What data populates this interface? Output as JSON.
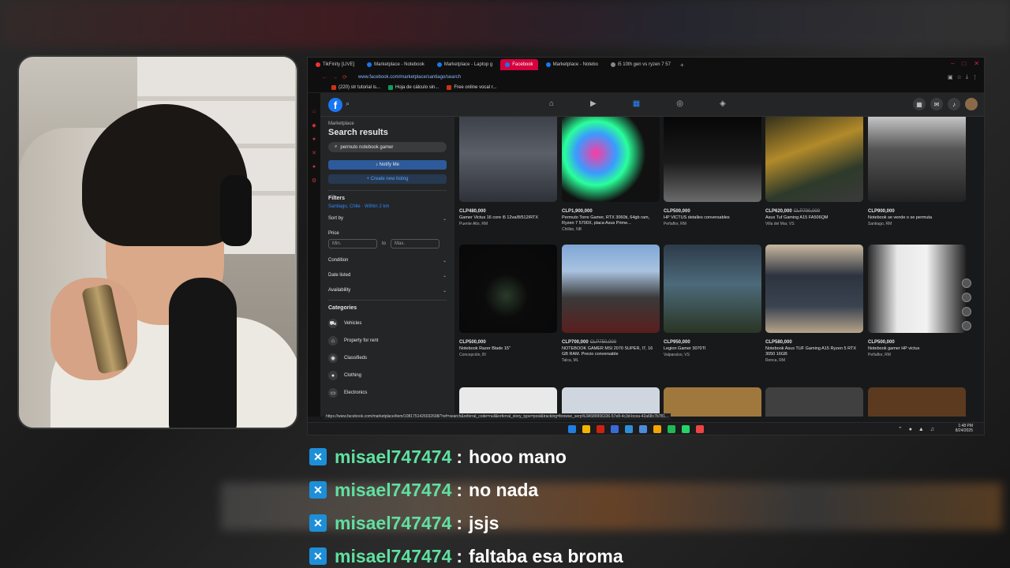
{
  "browser": {
    "tabs": [
      {
        "label": "TikFinity [LIVE]",
        "active": false
      },
      {
        "label": "Marketplace - Notebook",
        "active": false
      },
      {
        "label": "Marketplace - Laptop g",
        "active": false
      },
      {
        "label": "Facebook",
        "active": true
      },
      {
        "label": "Marketplace - Notebo",
        "active": false
      },
      {
        "label": "i5 10th gen vs ryzen 7 57",
        "active": false
      }
    ],
    "url": "www.facebook.com/marketplace/santiago/search",
    "bookmarks": [
      "(220) str tutorial is...",
      "Hoja de cálculo sin...",
      "Free online vocal r..."
    ],
    "status_url": "https://www.facebook.com/marketplace/item/1081751426032698/?ref=search&referral_code=null&referral_story_type=post&tracking=browse_serp%3A589906336-57e8-4c3d-bcea-42a68c7b781..."
  },
  "sidebar": {
    "breadcrumb": "Marketplace",
    "title": "Search results",
    "search_value": "permuto notebook gamer",
    "notify_label": "Notify Me",
    "create_label": "+ Create new listing",
    "filters_label": "Filters",
    "location": "Santiago, Chile · Within 2 km",
    "sort_label": "Sort by",
    "price_label": "Price",
    "min_placeholder": "Min.",
    "to_label": "to",
    "max_placeholder": "Max.",
    "condition_label": "Condition",
    "date_label": "Date listed",
    "availability_label": "Availability",
    "categories_label": "Categories",
    "categories": [
      {
        "label": "Vehicles",
        "icon": "car-icon"
      },
      {
        "label": "Property for rent",
        "icon": "house-icon"
      },
      {
        "label": "Classifieds",
        "icon": "tag-icon"
      },
      {
        "label": "Clothing",
        "icon": "shirt-icon"
      },
      {
        "label": "Electronics",
        "icon": "monitor-icon"
      }
    ]
  },
  "listings": [
    {
      "price": "CLP480,000",
      "old": "",
      "title": "Gamer Victus 16 core i5 12va/8/512/RTX",
      "loc": "Puente Alto, RM",
      "thumb": "laptop-keyboard"
    },
    {
      "price": "CLP1,900,000",
      "old": "",
      "title": "Permuto Torre Gamer, RTX 3060ti, 64gb ram, Ryzen 7 5700X, placa Asus Prime...",
      "loc": "Chillán, NB",
      "thumb": "rgb-pc"
    },
    {
      "price": "CLP500,000",
      "old": "",
      "title": "HP VICTUS detalles conversables",
      "loc": "Peñaflor, RM",
      "thumb": "laptop-orange"
    },
    {
      "price": "CLP620,000",
      "old": "CLP700,000",
      "title": "Asus Tuf Gaming A15 FA506QM",
      "loc": "Villa del Mar, VS",
      "thumb": "laptop-game"
    },
    {
      "price": "CLP900,000",
      "old": "",
      "title": "Notebook se vende o se permuta",
      "loc": "Santiago, RM",
      "thumb": "laptop-dark"
    },
    {
      "price": "CLP500,000",
      "old": "",
      "title": "Notebook Razer Blade 15\"",
      "loc": "Concepción, BI",
      "thumb": "razer"
    },
    {
      "price": "CLP700,000",
      "old": "CLP750,000",
      "title": "NOTEBOOK GAMER MSI 2070 SUPER, I7, 16 GB RAM. Precio conversable",
      "loc": "Talca, ML",
      "thumb": "laptop-lighthouse"
    },
    {
      "price": "CLP950,000",
      "old": "",
      "title": "Legion Gamer 3070TI",
      "loc": "Valparaíso, VS",
      "thumb": "game-scene"
    },
    {
      "price": "CLP580,000",
      "old": "",
      "title": "Notebook Asus TUF Gaming A15 Ryzen 5 RTX 3050 16GB",
      "loc": "Renca, RM",
      "thumb": "laptop-closed"
    },
    {
      "price": "CLP500,000",
      "old": "",
      "title": "Notebook gamer HP victus",
      "loc": "Peñaflor, RM",
      "thumb": "laptop-white"
    }
  ],
  "taskbar": {
    "time": "1:48 PM",
    "date": "8/24/2025"
  },
  "chat": [
    {
      "user": "misael747474",
      "msg": "hooo mano"
    },
    {
      "user": "misael747474",
      "msg": "no nada"
    },
    {
      "user": "misael747474",
      "msg": "jsjs"
    },
    {
      "user": "misael747474",
      "msg": "faltaba esa broma"
    }
  ],
  "colors": {
    "chat_user": "#5fe0a0",
    "fb_blue": "#1877f2",
    "active_tab": "#d6003d"
  }
}
